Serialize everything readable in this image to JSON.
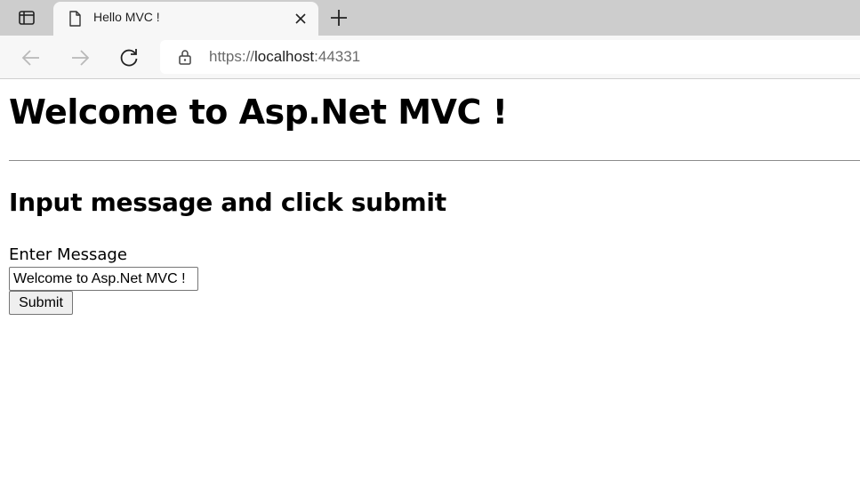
{
  "browser": {
    "tab": {
      "title": "Hello MVC !"
    },
    "address": {
      "scheme": "https://",
      "host": "localhost",
      "port": ":44331"
    },
    "icons": {
      "tab_actions": "tab-actions-icon",
      "favicon": "page-icon",
      "close": "close-icon",
      "new_tab": "plus-icon",
      "back": "arrow-left-icon",
      "forward": "arrow-right-icon",
      "reload": "reload-icon",
      "lock": "lock-icon"
    }
  },
  "page": {
    "heading": "Welcome to Asp.Net MVC !",
    "subheading": "Input message and click submit",
    "form": {
      "label": "Enter Message",
      "input_value": "Welcome to Asp.Net MVC !",
      "submit_label": "Submit"
    }
  }
}
